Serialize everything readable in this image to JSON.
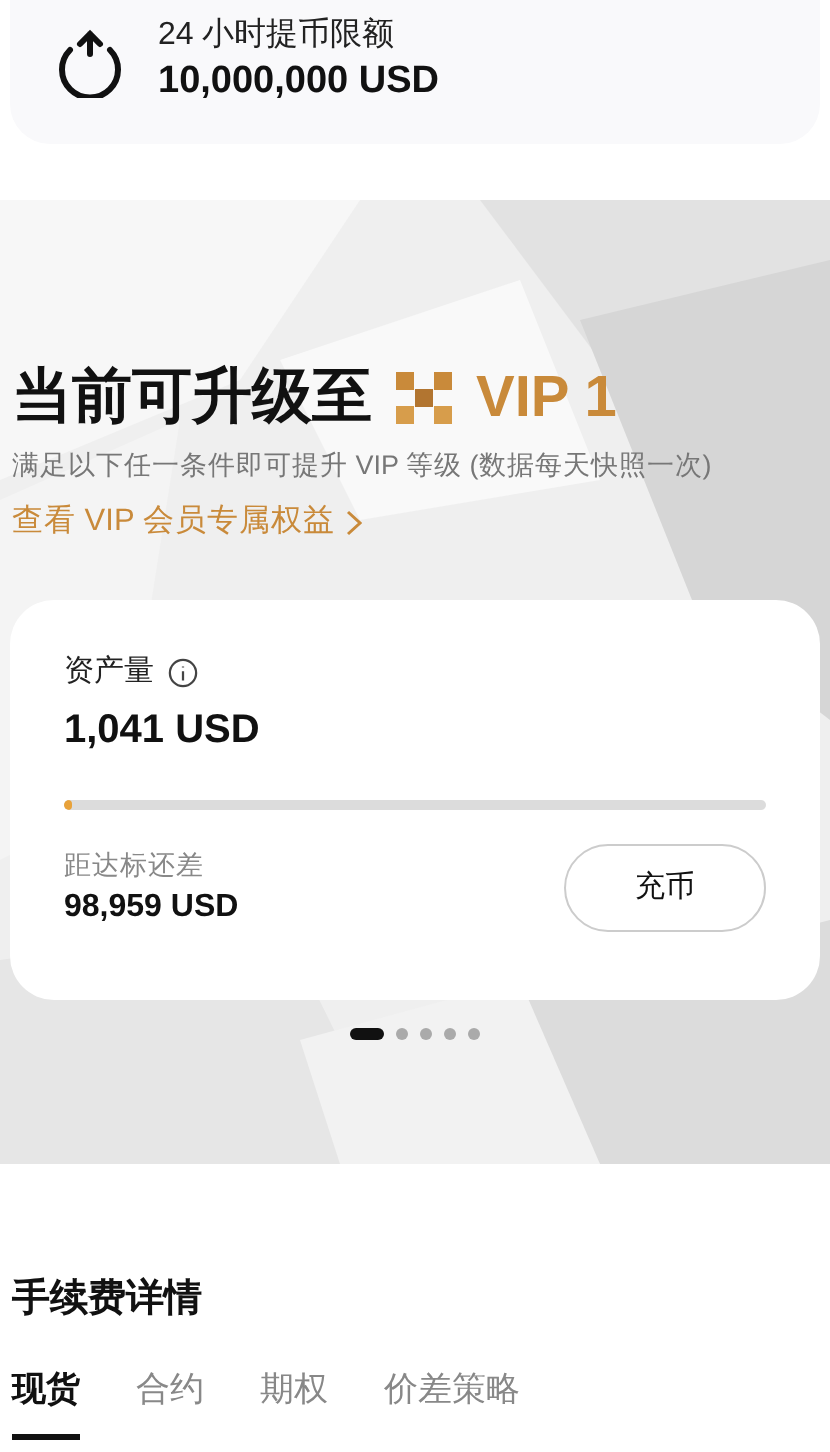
{
  "withdraw_limit": {
    "label": "24 小时提币限额",
    "value": "10,000,000 USD"
  },
  "upgrade": {
    "title": "当前可升级至",
    "vip_level": "VIP 1",
    "subtitle": "满足以下任一条件即可提升 VIP 等级 (数据每天快照一次)",
    "link": "查看 VIP 会员专属权益"
  },
  "asset_card": {
    "label": "资产量",
    "value": "1,041 USD",
    "level": 0.01,
    "gap_label": "距达标还差",
    "gap_value": "98,959 USD",
    "button": "充币"
  },
  "pager": [
    {
      "selected": true
    },
    {
      "selected": false
    },
    {
      "selected": false
    },
    {
      "selected": false
    },
    {
      "selected": false
    }
  ],
  "fees": {
    "title": "手续费详情"
  },
  "tabs": [
    {
      "label": "现货",
      "selected": true
    },
    {
      "label": "合约",
      "selected": false
    },
    {
      "label": "期权",
      "selected": false
    },
    {
      "label": "价差策略",
      "selected": false
    }
  ]
}
